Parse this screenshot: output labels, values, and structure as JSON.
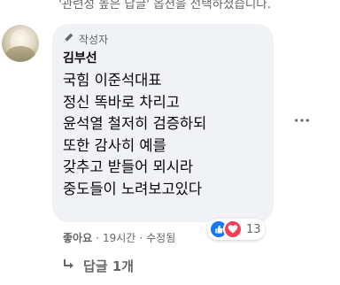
{
  "top_note": "'관련성 높은 답글' 옵션을 선택하셨습니다.",
  "comment": {
    "author_badge": "작성자",
    "author_name": "김부선",
    "lines": [
      "국힘 이준석대표",
      "정신 똑바로 차리고",
      "윤석열 철저히 검증하되",
      "또한 감사히 예를",
      "갖추고 받들어 뫼시라",
      "중도들이 노려보고있다"
    ],
    "more_icon": "more-horizontal-icon"
  },
  "reactions": {
    "icons": [
      "like-icon",
      "love-icon"
    ],
    "count": "13",
    "colors": {
      "like": "#1877f2",
      "love": "#f33e58"
    }
  },
  "actions": {
    "like": "좋아요",
    "dot": "·",
    "time": "19시간",
    "edited": "수정됨"
  },
  "replies": {
    "label": "답글 1개",
    "icon": "reply-arrow-icon"
  }
}
